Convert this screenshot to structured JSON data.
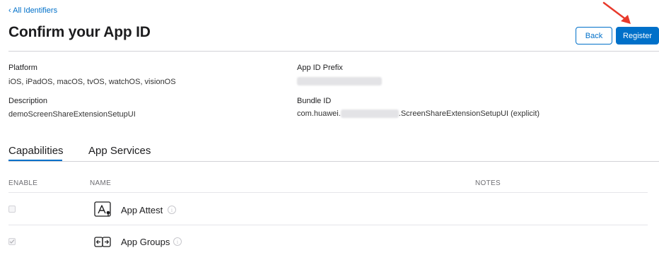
{
  "nav": {
    "back_link": "‹ All Identifiers"
  },
  "page": {
    "title": "Confirm your App ID"
  },
  "actions": {
    "back_label": "Back",
    "register_label": "Register"
  },
  "details": {
    "platform_label": "Platform",
    "platform_value": "iOS, iPadOS, macOS, tvOS, watchOS, visionOS",
    "prefix_label": "App ID Prefix",
    "description_label": "Description",
    "description_value": "demoScreenShareExtensionSetupUI",
    "bundle_label": "Bundle ID",
    "bundle_prefix": "com.huawei.",
    "bundle_suffix": ".ScreenShareExtensionSetupUI (explicit)"
  },
  "tabs": [
    {
      "label": "Capabilities",
      "active": true
    },
    {
      "label": "App Services",
      "active": false
    }
  ],
  "table": {
    "headers": {
      "enable": "ENABLE",
      "name": "NAME",
      "notes": "NOTES"
    },
    "rows": [
      {
        "name": "App Attest",
        "icon": "app-attest-icon",
        "enabled": false
      },
      {
        "name": "App Groups",
        "icon": "app-groups-icon",
        "enabled": true
      }
    ]
  },
  "colors": {
    "accent": "#0070c9",
    "annotation_arrow": "#e8392b"
  }
}
